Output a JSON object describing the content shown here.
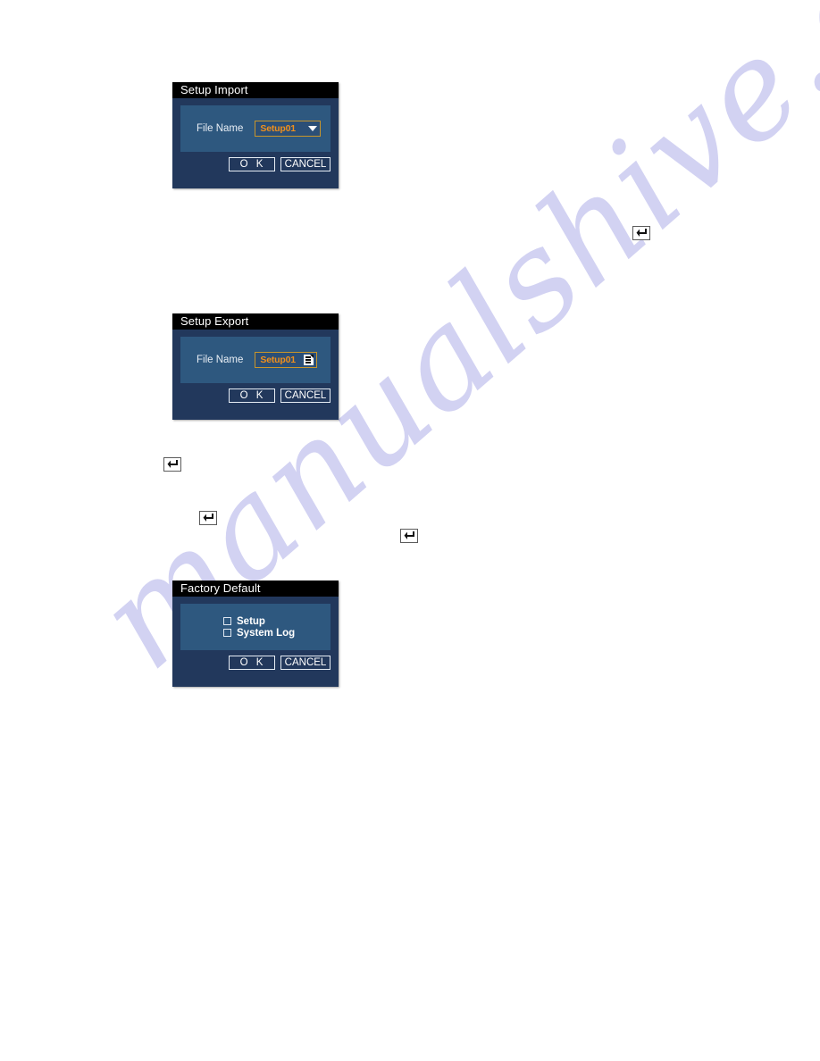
{
  "page": {
    "background_color": "#ffffff",
    "watermark": {
      "text": "manualshive.com",
      "color": "#d2d2f2"
    }
  },
  "dialogs": [
    {
      "id": "setup-import",
      "title": "Setup Import",
      "field_label": "File Name",
      "field_value": "Setup01",
      "field_control": "dropdown-caret-icon",
      "ok_label": "O  K",
      "cancel_label": "CANCEL"
    },
    {
      "id": "setup-export",
      "title": "Setup Export",
      "field_label": "File Name",
      "field_value": "Setup01",
      "field_control": "document-edit-icon",
      "ok_label": "O  K",
      "cancel_label": "CANCEL"
    },
    {
      "id": "factory-default",
      "title": "Factory Default",
      "checkboxes": [
        {
          "label": "Setup",
          "checked": false
        },
        {
          "label": "System Log",
          "checked": false
        }
      ],
      "ok_label": "O  K",
      "cancel_label": "CANCEL"
    }
  ],
  "enter_key_icons": [
    {
      "name": "enter-key-icon-1"
    },
    {
      "name": "enter-key-icon-2"
    },
    {
      "name": "enter-key-icon-3"
    },
    {
      "name": "enter-key-icon-4"
    }
  ],
  "colors": {
    "dialog_background": "#22385c",
    "inner_panel": "#2e587f",
    "titlebar": "#000000",
    "value_text": "#f0901c",
    "value_border": "#c8952a",
    "button_border": "#e6edf5"
  }
}
